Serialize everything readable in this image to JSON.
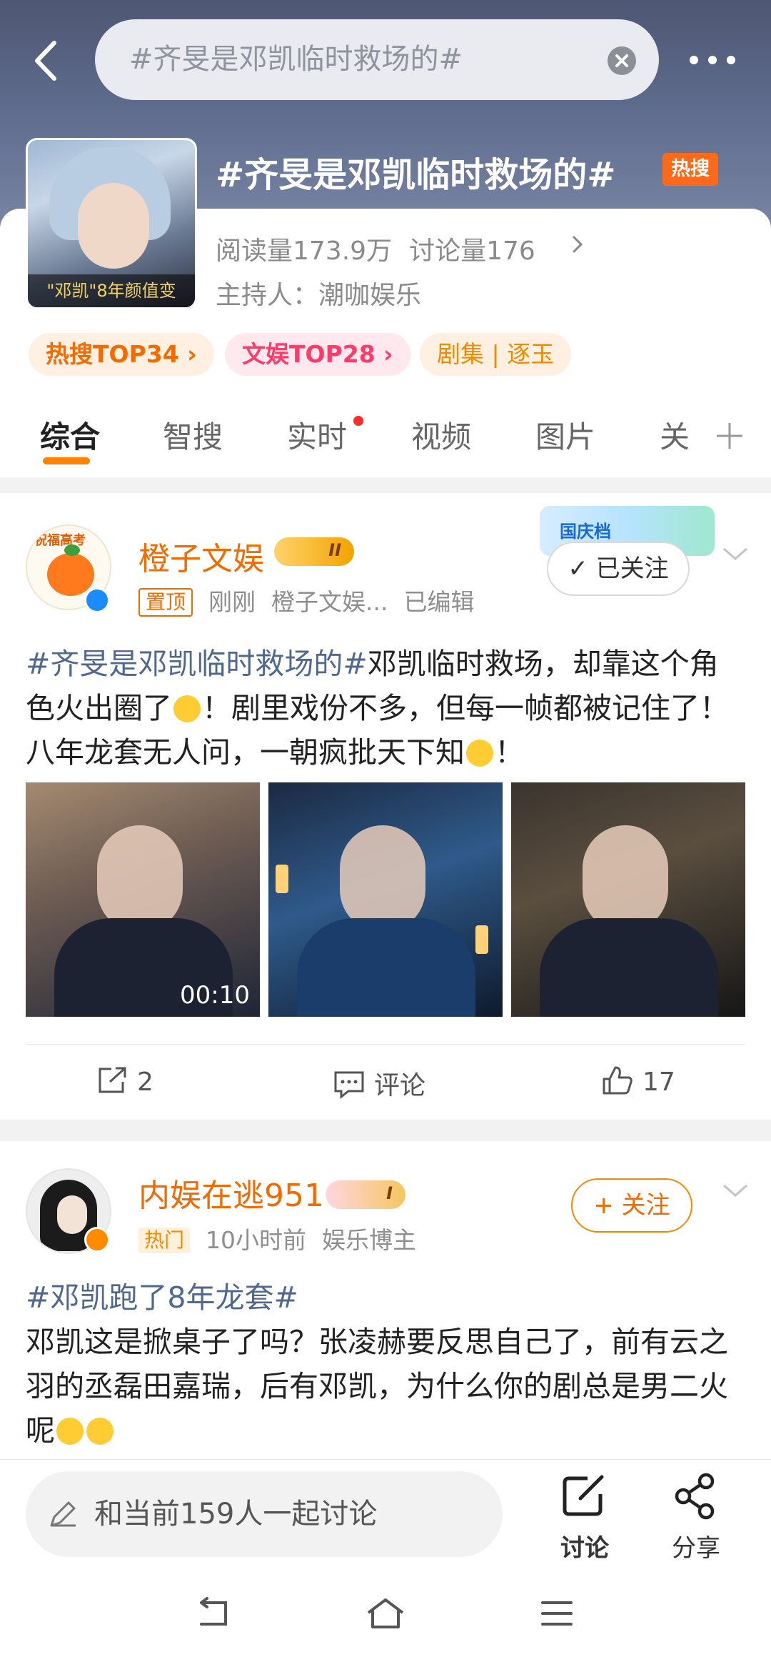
{
  "header": {
    "search_text": "#齐旻是邓凯临时救场的#",
    "topic_title": "#齐旻是邓凯临时救场的#",
    "hot_badge": "热搜",
    "cover_caption": "\"邓凯\"8年颜值变"
  },
  "info": {
    "reads": "阅读量173.9万",
    "discussions": "讨论量176",
    "host": "主持人：潮咖娱乐",
    "chips": [
      "热搜TOP34 ›",
      "文娱TOP28 ›",
      "剧集 | 逐玉"
    ]
  },
  "tabs": [
    "综合",
    "智搜",
    "实时",
    "视频",
    "图片",
    "关"
  ],
  "posts": [
    {
      "username": "橙子文娱",
      "level": "II",
      "avatar_text": "祝福高考",
      "pin_tag": "置顶",
      "time": "刚刚",
      "source": "橙子文娱...",
      "edited": "已编辑",
      "festival_text": "国庆档",
      "follow_label": "✓ 已关注",
      "hashtag": "#齐旻是邓凯临时救场的#",
      "text_1": "邓凯临时救场，却靠这个角色火出圈了",
      "text_2": "！剧里戏份不多，但每一帧都被记住了！八年龙套无人问，一朝疯批天下知",
      "text_3": "！",
      "video_duration": "00:10",
      "shares": "2",
      "comment_label": "评论",
      "likes": "17"
    },
    {
      "username": "内娱在逃951",
      "level": "I",
      "hot_tag": "热门",
      "time": "10小时前",
      "role": "娱乐博主",
      "follow_label": "+ 关注",
      "hashtag": "#邓凯跑了8年龙套#",
      "text": "邓凯这是掀桌子了吗？张凌赫要反思自己了，前有云之羽的丞磊田嘉瑞，后有邓凯，为什么你的剧总是男二火呢"
    }
  ],
  "bottom": {
    "discuss_placeholder": "和当前159人一起讨论",
    "discuss_label": "讨论",
    "share_label": "分享"
  },
  "colors": {
    "accent": "#ff8200",
    "hashtag": "#50678e",
    "username": "#f26b00"
  }
}
